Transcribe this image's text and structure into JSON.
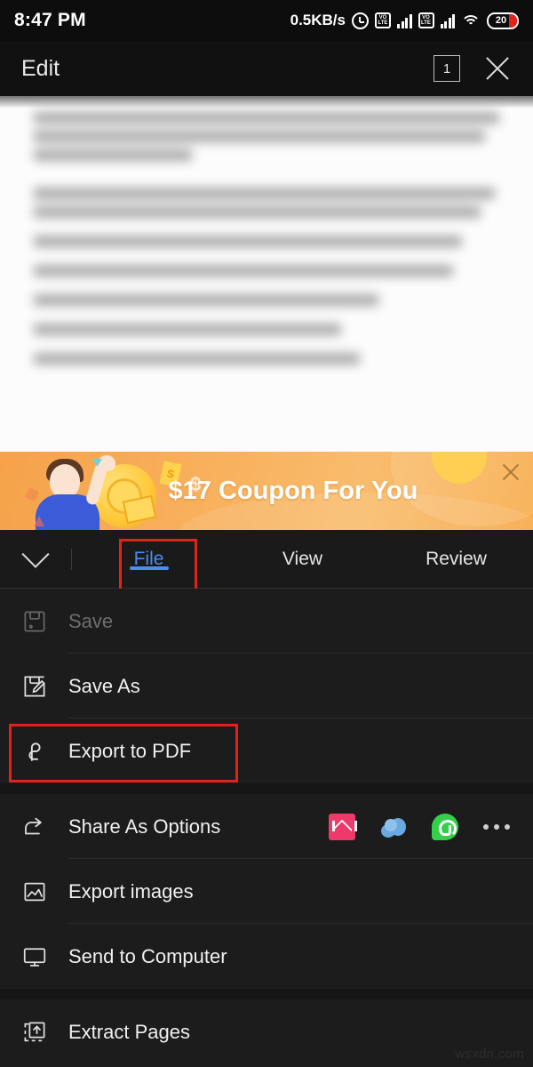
{
  "status_bar": {
    "time": "8:47 PM",
    "network_speed": "0.5KB/s",
    "alarm_icon": "alarm-icon",
    "sim1_volte": "VO\nLTE",
    "sim2_volte": "VO\nLTE",
    "wifi_icon": "wifi-icon",
    "battery_percent": "20",
    "battery_color": "#e2231a"
  },
  "app_bar": {
    "title": "Edit",
    "page_count": "1",
    "close_icon": "close-icon"
  },
  "document": {
    "content_state": "blurred-text-preview"
  },
  "banner": {
    "text": "$17 Coupon For You",
    "dollar_mark": "$",
    "tag_mark": "S",
    "close_icon": "close-icon",
    "background_color": "#f8b05c",
    "text_color": "#ffffff"
  },
  "tab_bar": {
    "collapse_icon": "chevron-down-icon",
    "tabs": [
      {
        "label": "File",
        "active": true
      },
      {
        "label": "View",
        "active": false
      },
      {
        "label": "Review",
        "active": false
      }
    ],
    "active_color": "#4a8cf0",
    "highlight_color": "#e2231a"
  },
  "menu": {
    "items": [
      {
        "label": "Save",
        "icon": "save-icon",
        "disabled": true
      },
      {
        "label": "Save As",
        "icon": "save-as-icon",
        "disabled": false
      },
      {
        "label": "Export to PDF",
        "icon": "export-pdf-icon",
        "disabled": false,
        "highlighted": true
      },
      {
        "label": "Share As Options",
        "icon": "share-icon",
        "disabled": false
      },
      {
        "label": "Export images",
        "icon": "image-icon",
        "disabled": false
      },
      {
        "label": "Send to Computer",
        "icon": "monitor-icon",
        "disabled": false
      },
      {
        "label": "Extract Pages",
        "icon": "extract-pages-icon",
        "disabled": false
      }
    ],
    "share_targets": [
      {
        "name": "email-icon",
        "color": "#ee3a6b"
      },
      {
        "name": "cloud-icon",
        "color": "#6aa9e0"
      },
      {
        "name": "whatsapp-icon",
        "color": "#35d04b"
      },
      {
        "name": "more-icon",
        "color": "#cfcfcf"
      }
    ]
  },
  "watermark": {
    "text": "wsxdn.com"
  }
}
